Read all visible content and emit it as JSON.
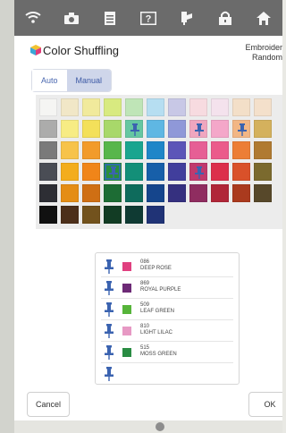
{
  "toolbar": {
    "icons": [
      "wifi-icon",
      "camera-icon",
      "document-icon",
      "help-icon",
      "threading-icon",
      "lock-icon",
      "home-icon"
    ]
  },
  "header": {
    "title": "Color Shuffling",
    "mode_line1": "Embroider",
    "mode_line2": "Random"
  },
  "tabs": [
    {
      "label": "Auto",
      "active": false
    },
    {
      "label": "Manual",
      "active": true
    }
  ],
  "palette": {
    "rows": [
      [
        "#f5f5f3",
        "#f1e7c7",
        "#f1ea9c",
        "#d8ea80",
        "#bfe5b7",
        "#b6def1",
        "#c8c8e6",
        "#f7dbe0",
        "#f4e2ed",
        "#f3dfc8",
        "#f4e0cb"
      ],
      [
        "#acacab",
        "#f7ec84",
        "#f3e05a",
        "#a8d86a",
        "#66c7a2",
        "#5fb7e3",
        "#8f98d8",
        "#f0a6bf",
        "#f4a7c9",
        "#f2b685",
        "#d4b15d"
      ],
      [
        "#7a7a7a",
        "#f7c34a",
        "#f29b2b",
        "#58b64b",
        "#1aa58f",
        "#1f86c8",
        "#5c55b8",
        "#e65f95",
        "#eb5b8b",
        "#ec7e36",
        "#b07a31"
      ],
      [
        "#4a4d55",
        "#f3ad1c",
        "#f08519",
        "#2a8f3c",
        "#138f78",
        "#175fa9",
        "#413e9c",
        "#c03a6d",
        "#dc2f4b",
        "#d9512a",
        "#7b6a2e"
      ],
      [
        "#2d2e34",
        "#e48d15",
        "#cf6f14",
        "#1d6c34",
        "#0e6b5c",
        "#15458c",
        "#35307f",
        "#8f2d60",
        "#b02638",
        "#aa3a1e",
        "#57482a"
      ],
      [
        "#111111",
        "#4c2f1a",
        "#72521d",
        "#123c24",
        "#0f3a33",
        "#203376",
        "",
        "",
        "",
        "",
        ""
      ]
    ],
    "pinned": [
      [
        1,
        4
      ],
      [
        1,
        7
      ],
      [
        1,
        9
      ],
      [
        3,
        3
      ],
      [
        3,
        7
      ]
    ],
    "selected": [
      3,
      3
    ]
  },
  "threads": [
    {
      "code": "086",
      "name": "DEEP ROSE",
      "color": "#e0407f"
    },
    {
      "code": "869",
      "name": "ROYAL PURPLE",
      "color": "#6d2a76"
    },
    {
      "code": "509",
      "name": "LEAF GREEN",
      "color": "#56b43a"
    },
    {
      "code": "810",
      "name": "LIGHT LILAC",
      "color": "#e799c4"
    },
    {
      "code": "515",
      "name": "MOSS GREEN",
      "color": "#2a8c43"
    }
  ],
  "buttons": {
    "cancel": "Cancel",
    "ok": "OK"
  },
  "colors": {
    "toolbar": "#6b6b6b",
    "pin_blue": "#3b63b0",
    "accent": "#3d5aa5"
  }
}
